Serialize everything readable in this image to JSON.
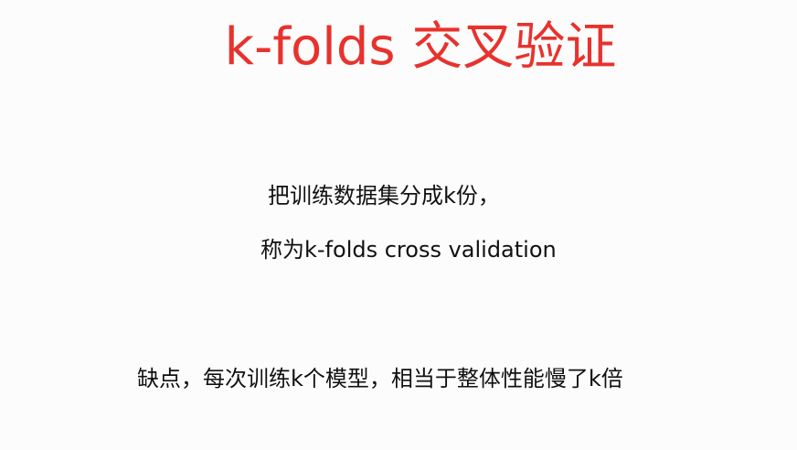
{
  "slide": {
    "title": "k-folds 交叉验证",
    "title_color": "#e8322d",
    "lines": [
      "把训练数据集分成k份，",
      "称为k-folds cross validation",
      "缺点，每次训练k个模型，相当于整体性能慢了k倍"
    ]
  }
}
